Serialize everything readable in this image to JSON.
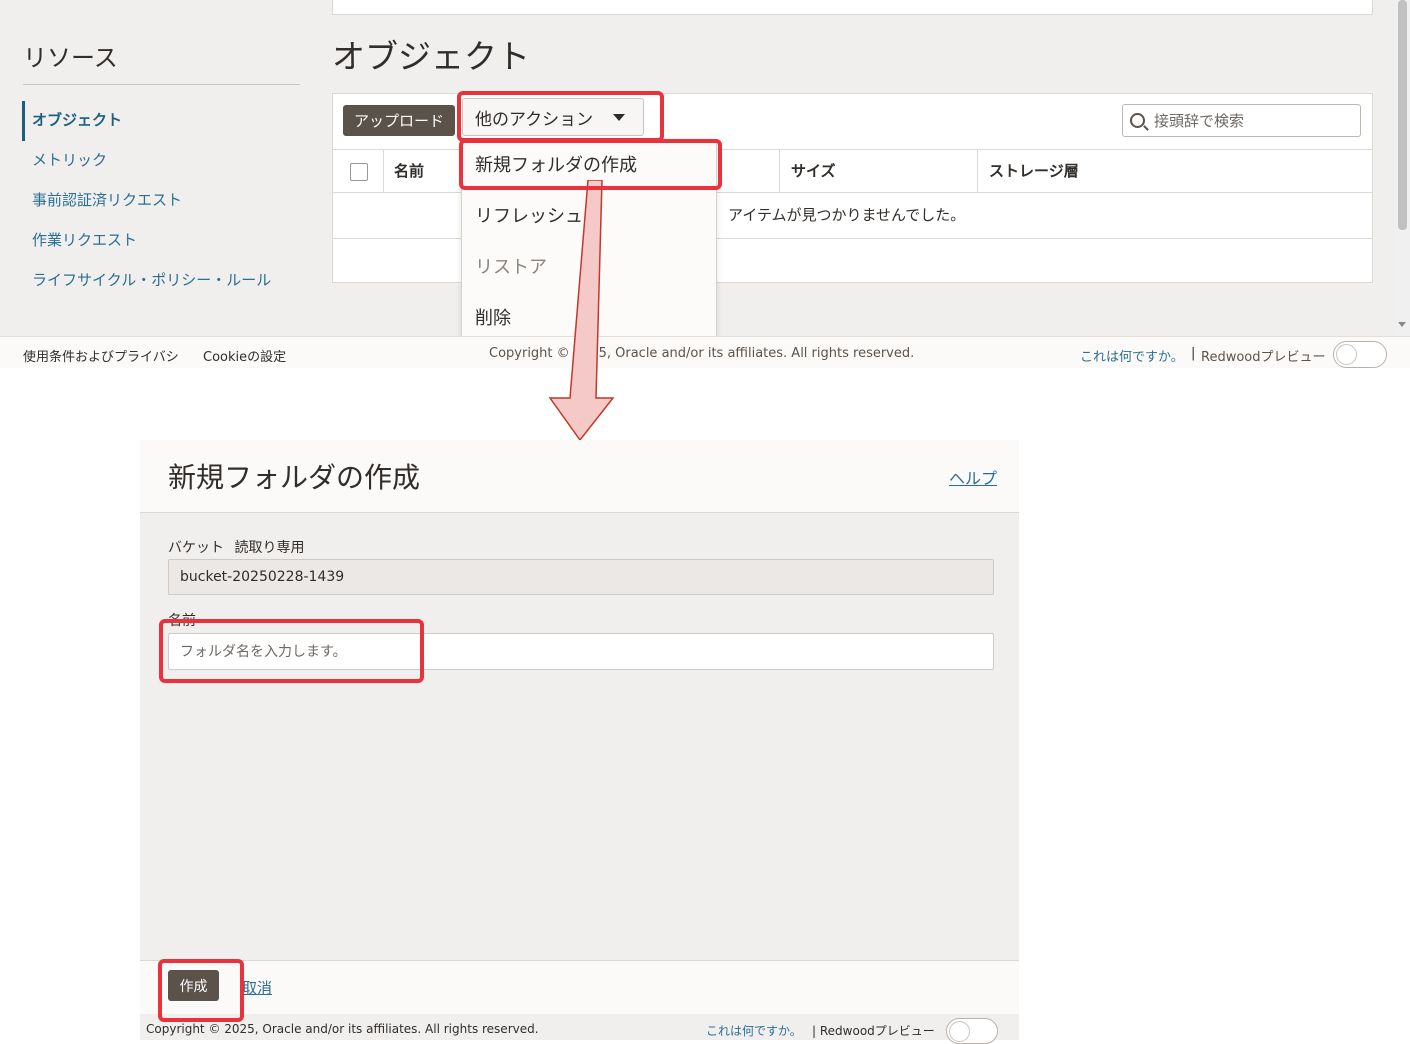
{
  "top": {
    "sidebar": {
      "title": "リソース",
      "items": [
        {
          "label": "オブジェクト",
          "active": true
        },
        {
          "label": "メトリック"
        },
        {
          "label": "事前認証済リクエスト"
        },
        {
          "label": "作業リクエスト"
        },
        {
          "label": "ライフサイクル・ポリシー・ルール"
        }
      ]
    },
    "page_title": "オブジェクト",
    "toolbar": {
      "upload_label": "アップロード",
      "more_actions_label": "他のアクション",
      "search_placeholder": "接頭辞で検索"
    },
    "table": {
      "columns": [
        "名前",
        "サイズ",
        "ストレージ層"
      ],
      "empty_message": "アイテムが見つかりませんでした。"
    },
    "dropdown": {
      "items": [
        {
          "label": "新規フォルダの作成",
          "disabled": false
        },
        {
          "label": "リフレッシュ",
          "disabled": false
        },
        {
          "label": "リストア",
          "disabled": true
        },
        {
          "label": "削除",
          "disabled": false
        }
      ]
    },
    "footer": {
      "terms": "使用条件およびプライバシ",
      "cookie": "Cookieの設定",
      "copyright": "Copyright © 2025, Oracle and/or its affiliates. All rights reserved.",
      "what_is": "これは何ですか。",
      "separator": "|",
      "redwood": "Redwoodプレビュー"
    }
  },
  "dialog": {
    "title": "新規フォルダの作成",
    "help": "ヘルプ",
    "bucket_label": "バケット",
    "readonly_label": "読取り専用",
    "bucket_value": "bucket-20250228-1439",
    "name_label": "名前",
    "name_placeholder": "フォルダ名を入力します。",
    "create_label": "作成",
    "cancel_label": "取消",
    "footer": {
      "copyright": "Copyright © 2025, Oracle and/or its affiliates. All rights reserved.",
      "what_is": "これは何ですか。",
      "separator": "|",
      "redwood": "Redwoodプレビュー"
    }
  },
  "colors": {
    "highlight": "#e8323c",
    "arrow_fill": "#f6c9c9",
    "arrow_stroke": "#c0392b",
    "link": "#2a6f93",
    "primary_button": "#5b524a"
  }
}
